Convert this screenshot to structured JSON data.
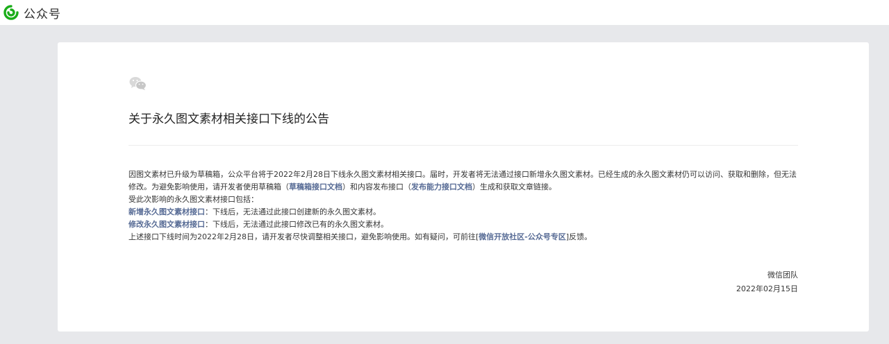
{
  "app": {
    "name": "公众号",
    "logo_icon": "wechat-official-account-logo-icon",
    "accent_color": "#1aad19"
  },
  "notice": {
    "icon": "wechat-chat-icon",
    "title": "关于永久图文素材相关接口下线的公告",
    "para1_a": "因图文素材已升级为草稿箱，公众平台将于2022年2月28日下线永久图文素材相关接口。届时，开发者将无法通过接口新增永久图文素材。已经生成的永久图文素材仍可以访问、获取和删除，但无法修改。为避免影响使用，请开发者使用草稿箱（",
    "link_draft": "草稿箱接口文档",
    "para1_b": "）和内容发布接口（",
    "link_publish": "发布能力接口文档",
    "para1_c": "）生成和获取文章链接。",
    "affected_intro": "受此次影响的永久图文素材接口包括：",
    "item1_name": "新增永久图文素材接口",
    "item1_desc": "：下线后，无法通过此接口创建新的永久图文素材。",
    "item2_name": "修改永久图文素材接口",
    "item2_desc": "：下线后，无法通过此接口修改已有的永久图文素材。",
    "closing_a": "上述接口下线时间为2022年2月28日，请开发者尽快调整相关接口，避免影响使用。如有疑问，可前往[",
    "link_community": "微信开放社区-公众号专区",
    "closing_b": "]反馈。",
    "signature": "微信团队",
    "date": "2022年02月15日",
    "link_color": "#576b95"
  }
}
